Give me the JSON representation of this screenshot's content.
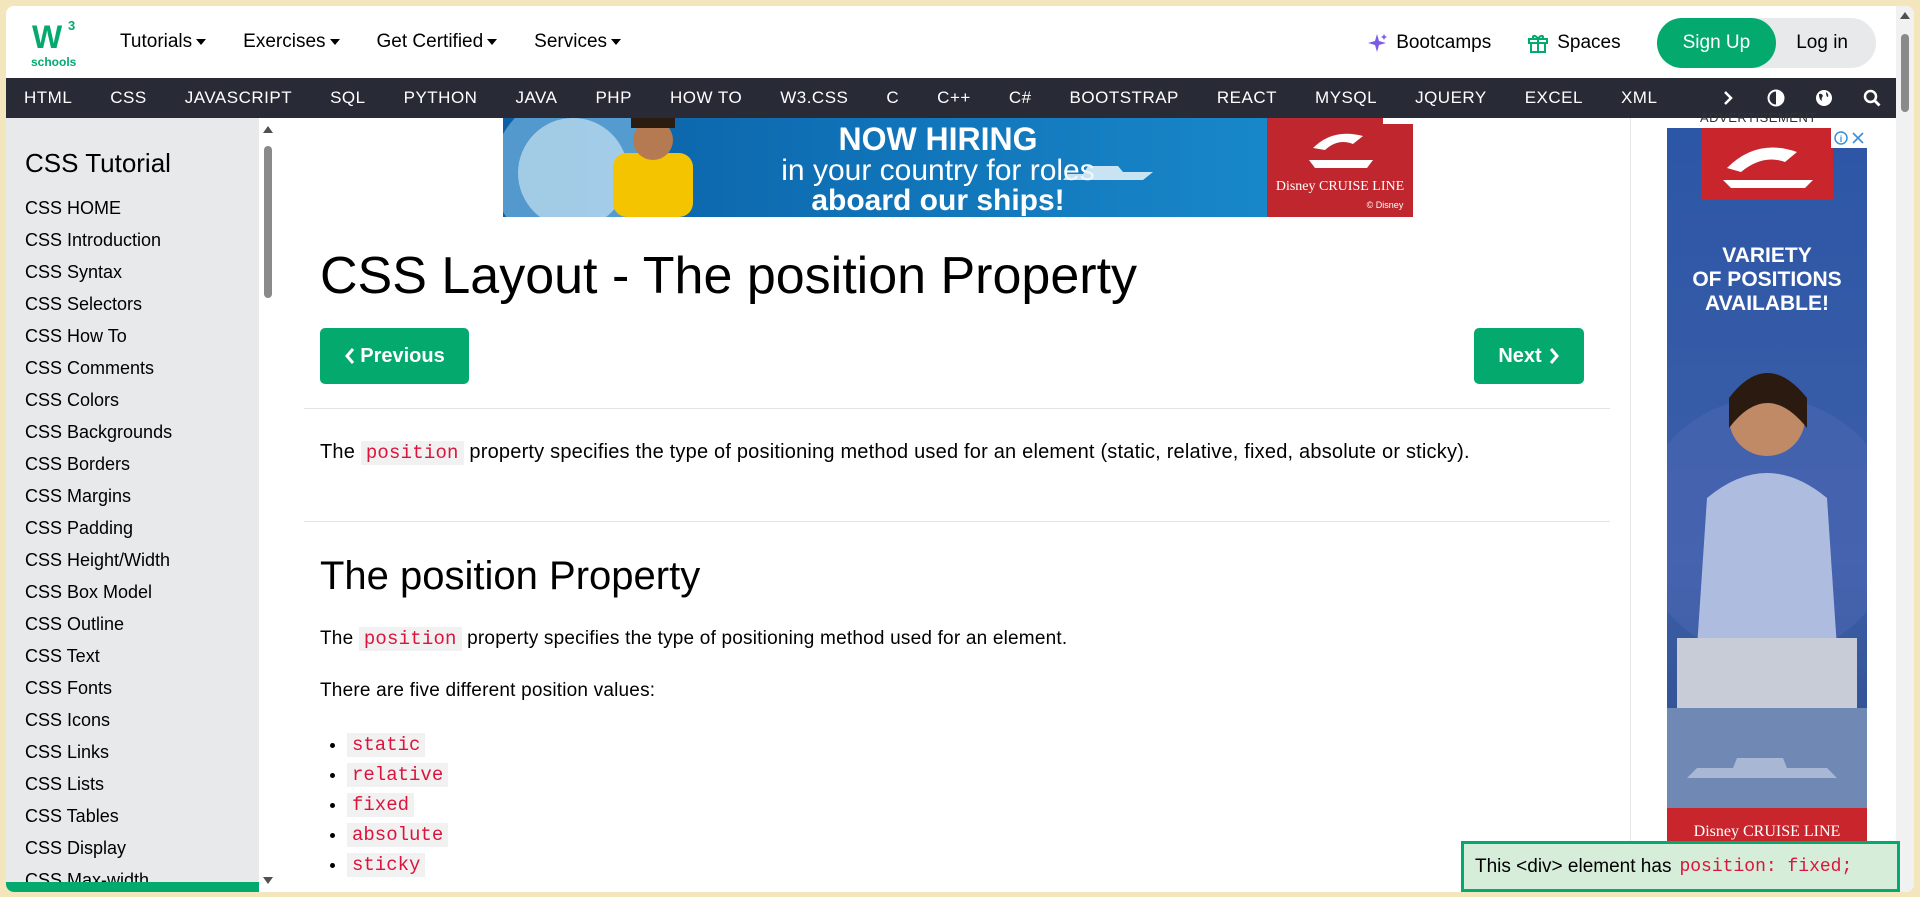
{
  "topbar": {
    "logo_number": "3",
    "logo_sub": "schools",
    "menu": [
      {
        "label": "Tutorials"
      },
      {
        "label": "Exercises"
      },
      {
        "label": "Get Certified"
      },
      {
        "label": "Services"
      }
    ],
    "bootcamps": "Bootcamps",
    "spaces": "Spaces",
    "signup": "Sign Up",
    "login": "Log in"
  },
  "navbar": {
    "items": [
      "HTML",
      "CSS",
      "JAVASCRIPT",
      "SQL",
      "PYTHON",
      "JAVA",
      "PHP",
      "HOW TO",
      "W3.CSS",
      "C",
      "C++",
      "C#",
      "BOOTSTRAP",
      "REACT",
      "MYSQL",
      "JQUERY",
      "EXCEL",
      "XML"
    ]
  },
  "sidebar": {
    "title": "CSS Tutorial",
    "items": [
      "CSS HOME",
      "CSS Introduction",
      "CSS Syntax",
      "CSS Selectors",
      "CSS How To",
      "CSS Comments",
      "CSS Colors",
      "CSS Backgrounds",
      "CSS Borders",
      "CSS Margins",
      "CSS Padding",
      "CSS Height/Width",
      "CSS Box Model",
      "CSS Outline",
      "CSS Text",
      "CSS Fonts",
      "CSS Icons",
      "CSS Links",
      "CSS Lists",
      "CSS Tables",
      "CSS Display",
      "CSS Max-width"
    ]
  },
  "ad_top": {
    "line1": "NOW HIRING",
    "line2": "in your country for roles",
    "line3": "aboard our ships!",
    "brand": "Disney CRUISE LINE",
    "brand_sub": "© Disney"
  },
  "main": {
    "title": "CSS Layout - The position Property",
    "prev": "Previous",
    "next": "Next",
    "intro_pre": "The ",
    "intro_code": "position",
    "intro_post": " property specifies the type of positioning method used for an element (static, relative, fixed, absolute or sticky).",
    "subtitle": "The position Property",
    "p2_pre": "The ",
    "p2_code": "position",
    "p2_post": " property specifies the type of positioning method used for an element.",
    "p3": "There are five different position values:",
    "values": [
      "static",
      "relative",
      "fixed",
      "absolute",
      "sticky"
    ]
  },
  "ad_right": {
    "label": "ADVERTISEMENT",
    "text": "VARIETY OF POSITIONS AVAILABLE!",
    "brand": "Disney CRUISE LINE"
  },
  "fixed_box": {
    "text": "This <div> element has",
    "code": "position: fixed;"
  },
  "colors": {
    "accent": "#04aa6d",
    "navbar": "#282a35",
    "sidebar": "#e7e9eb",
    "code": "#dc143c"
  }
}
